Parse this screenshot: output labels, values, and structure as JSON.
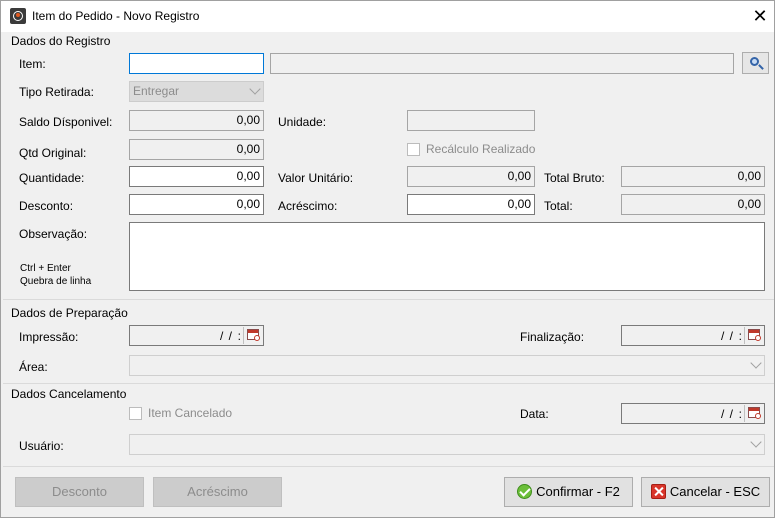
{
  "window": {
    "title": "Item do Pedido - Novo Registro",
    "close_glyph": "✕"
  },
  "sections": {
    "registro": "Dados do Registro",
    "preparacao": "Dados de Preparação",
    "cancelamento": "Dados Cancelamento"
  },
  "registro": {
    "item_label": "Item:",
    "item_value": "",
    "item_description": "",
    "tipo_retirada_label": "Tipo Retirada:",
    "tipo_retirada_value": "Entregar",
    "saldo_label": "Saldo Dísponivel:",
    "saldo_value": "0,00",
    "unidade_label": "Unidade:",
    "unidade_value": "",
    "qtd_original_label": "Qtd Original:",
    "qtd_original_value": "0,00",
    "recalculo_label": "Recálculo Realizado",
    "quantidade_label": "Quantidade:",
    "quantidade_value": "0,00",
    "valor_unitario_label": "Valor Unitário:",
    "valor_unitario_value": "0,00",
    "total_bruto_label": "Total Bruto:",
    "total_bruto_value": "0,00",
    "desconto_label": "Desconto:",
    "desconto_value": "0,00",
    "acrescimo_label": "Acréscimo:",
    "acrescimo_value": "0,00",
    "total_label": "Total:",
    "total_value": "0,00",
    "observacao_label": "Observação:",
    "observacao_hint_1": "Ctrl + Enter",
    "observacao_hint_2": "Quebra de linha"
  },
  "preparacao": {
    "impressao_label": "Impressão:",
    "impressao_value": "/ /",
    "finalizacao_label": "Finalização:",
    "finalizacao_value": "/ /",
    "area_label": "Área:"
  },
  "cancelamento": {
    "item_cancelado_label": "Item Cancelado",
    "data_label": "Data:",
    "data_value": "/ /",
    "usuario_label": "Usuário:"
  },
  "footer": {
    "desconto_button": "Desconto",
    "acrescimo_button": "Acréscimo",
    "confirmar_button": "Confirmar - F2",
    "cancelar_button": "Cancelar - ESC"
  },
  "icons": [
    "app-icon",
    "close-icon",
    "search-icon",
    "calendar-icon",
    "confirm-check-icon",
    "cancel-x-icon"
  ],
  "colors": {
    "focus_border": "#0078d7",
    "confirm_green": "#6cbf3a",
    "cancel_red": "#d9352a"
  }
}
